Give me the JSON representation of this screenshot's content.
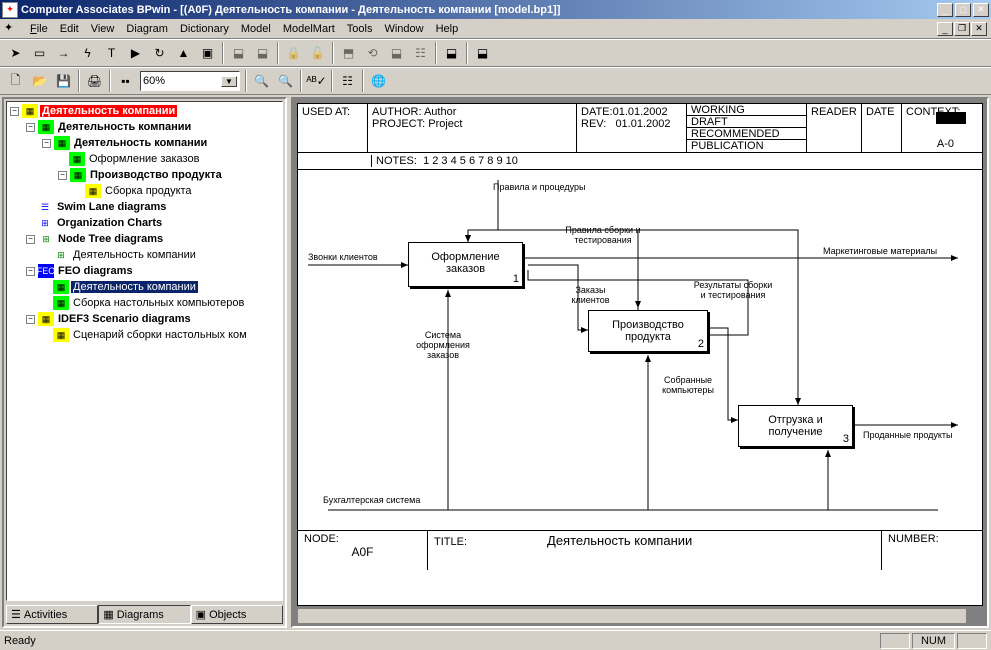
{
  "window": {
    "title": "Computer Associates BPwin - [(A0F) Деятельность компании - Деятельность компании  [model.bp1]]"
  },
  "menu": {
    "file": "File",
    "edit": "Edit",
    "view": "View",
    "diagram": "Diagram",
    "dictionary": "Dictionary",
    "model": "Model",
    "modelmart": "ModelMart",
    "tools": "Tools",
    "window": "Window",
    "help": "Help"
  },
  "zoom": "60%",
  "tree": {
    "root": "Деятельность компании",
    "n1": "Деятельность компании",
    "n2": "Деятельность компании",
    "n3": "Оформление заказов",
    "n4": "Производство продукта",
    "n5": "Сборка продукта",
    "swim": "Swim Lane diagrams",
    "org": "Organization Charts",
    "node": "Node Tree diagrams",
    "node1": "Деятельность компании",
    "feo": "FEO diagrams",
    "feo1": "Деятельность компании",
    "feo2": "Сборка настольных компьютеров",
    "idef3": "IDEF3 Scenario diagrams",
    "idef3_1": "Сценарий сборки настольных ком"
  },
  "tabs": {
    "activities": "Activities",
    "diagrams": "Diagrams",
    "objects": "Objects"
  },
  "header": {
    "used_at": "USED AT:",
    "author": "AUTHOR:",
    "author_v": "Author",
    "project": "PROJECT:",
    "project_v": "Project",
    "date": "DATE:",
    "date_v": "01.01.2002",
    "rev": "REV:",
    "rev_v": "01.01.2002",
    "working": "WORKING",
    "draft": "DRAFT",
    "recommended": "RECOMMENDED",
    "publication": "PUBLICATION",
    "reader": "READER",
    "date2": "DATE",
    "context": "CONTEXT:",
    "context_v": "A-0",
    "notes": "NOTES:",
    "notes_v": "1  2  3  4  5  6  7  8  9  10"
  },
  "diagram": {
    "rules": "Правила и процедуры",
    "calls": "Звонки клиентов",
    "box1": "Оформление заказов",
    "marketing": "Маркетинговые материалы",
    "assembly_rules": "Правила сборки и тестирования",
    "orders": "Заказы клиентов",
    "results": "Результаты сборки и тестирования",
    "box2": "Производство продукта",
    "system": "Система оформления заказов",
    "collected": "Собранные компьютеры",
    "box3": "Отгрузка и получение",
    "sold": "Проданные продукты",
    "accounting": "Бухгалтерская система"
  },
  "footer": {
    "node": "NODE:",
    "node_v": "A0F",
    "title": "TITLE:",
    "title_v": "Деятельность компании",
    "number": "NUMBER:"
  },
  "status": {
    "ready": "Ready",
    "num": "NUM"
  }
}
